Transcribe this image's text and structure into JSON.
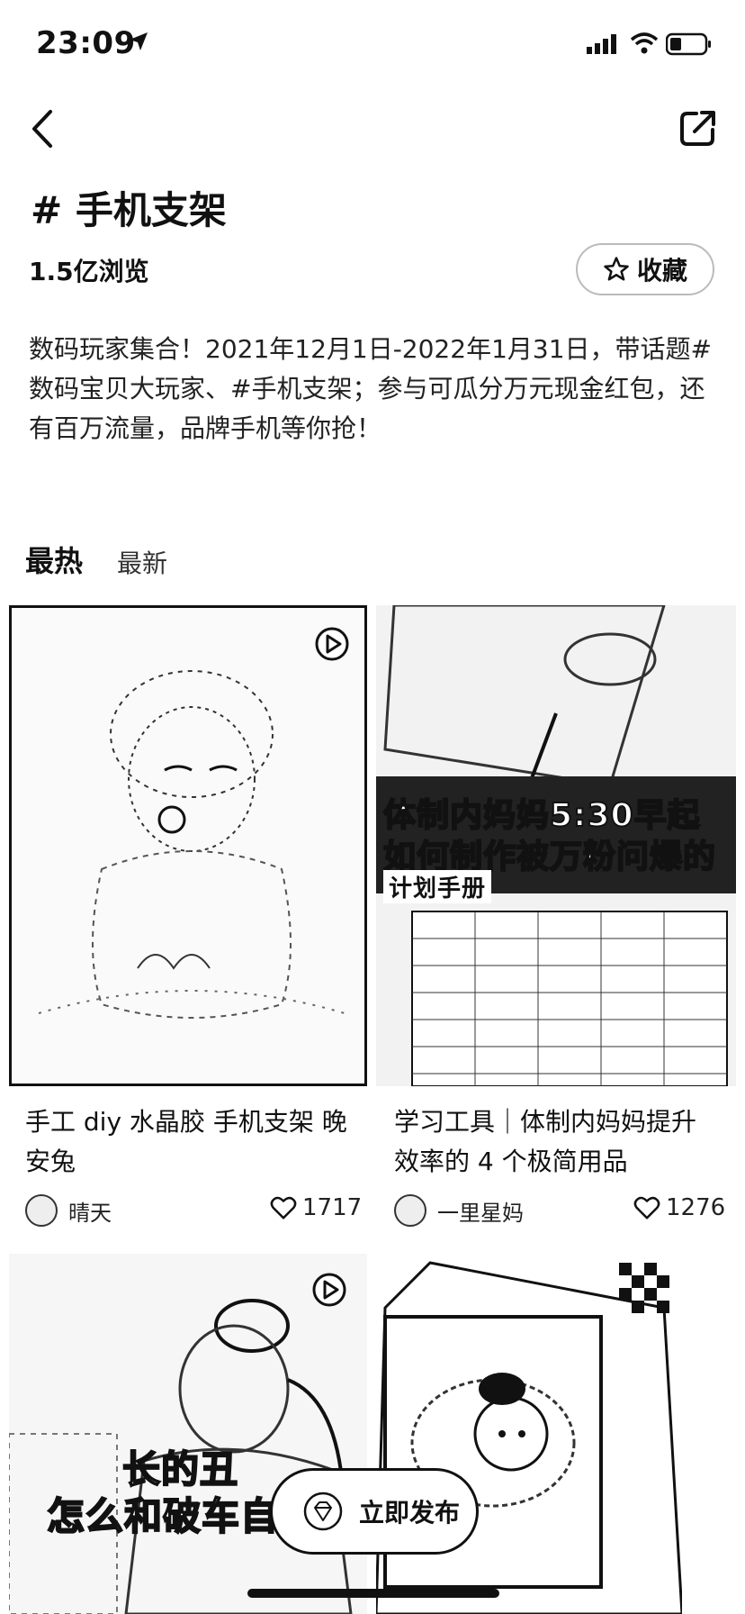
{
  "status": {
    "time": "23:09"
  },
  "topic": {
    "title": "# 手机支架",
    "views": "1.5亿浏览",
    "favorite_label": "收藏",
    "description": "数码玩家集合！2021年12月1日-2022年1月31日，带话题#数码宝贝大玩家、#手机支架；参与可瓜分万元现金红包，还有百万流量，品牌手机等你抢！"
  },
  "tabs": {
    "hot": "最热",
    "new": "最新"
  },
  "posts": [
    {
      "title": "手工 diy 水晶胶 手机支架 晚安兔",
      "author": "晴天",
      "likes": "1717",
      "is_video": true
    },
    {
      "title": "学习工具｜体制内妈妈提升效率的 4 个极简用品",
      "author": "一里星妈",
      "likes": "1276",
      "is_video": false,
      "overlay": [
        "体制内妈妈5:30早起",
        "如何制作被万粉问爆的",
        "计划手册"
      ]
    },
    {
      "overlay": [
        "长的丑",
        "怎么和破车自"
      ],
      "is_video": true
    },
    {
      "is_video": false
    }
  ],
  "publish": {
    "label": "立即发布"
  },
  "icons": [
    "location-arrow-icon",
    "signal-icon",
    "wifi-icon",
    "battery-icon",
    "back-icon",
    "share-icon",
    "star-icon",
    "play-icon",
    "heart-icon",
    "diamond-icon"
  ]
}
